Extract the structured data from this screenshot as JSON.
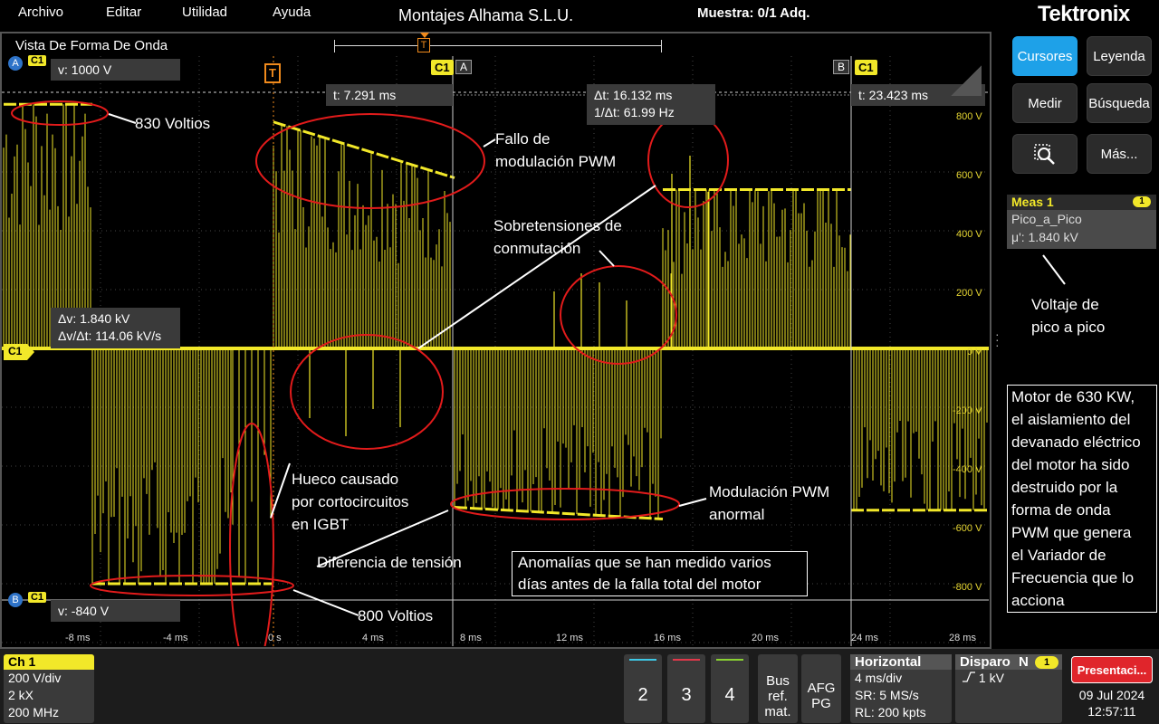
{
  "menu": {
    "items": [
      "Archivo",
      "Editar",
      "Utilidad",
      "Ayuda"
    ],
    "title": "Montajes Alhama S.L.U.",
    "sample": "Muestra: 0/1 Adq.",
    "brand": "Tektronix"
  },
  "waveform": {
    "title": "Vista De Forma De Onda",
    "trigger_marker": "T",
    "channel_tag": "C1",
    "cursor_a_label": "A",
    "cursor_b_label": "B",
    "cursor_v_top": "v: 1000 V",
    "cursor_v_bottom": "v: -840 V",
    "t_a": "t: 7.291 ms",
    "t_b": "t: 23.423 ms",
    "delta_t": "Δt: 16.132 ms",
    "inv_delta_t": "1/Δt: 61.99 Hz",
    "delta_v": "Δv: 1.840 kV",
    "dv_dt": "Δv/Δt: 114.06 kV/s",
    "y_labels": [
      "800 V",
      "600 V",
      "400 V",
      "200 V",
      "0 V",
      "-200 V",
      "-400 V",
      "-600 V",
      "-800 V"
    ],
    "x_labels": [
      "-8 ms",
      "-4 ms",
      "0 s",
      "4 ms",
      "8 ms",
      "12 ms",
      "16 ms",
      "20 ms",
      "24 ms",
      "28 ms"
    ],
    "trace_color": "#f2e829",
    "annotation_color": "#e21b1b"
  },
  "annotations": {
    "v830": "830 Voltios",
    "pwm_fail": [
      "Fallo de",
      "modulación PWM"
    ],
    "overvolt": [
      "Sobretensiones de",
      "conmutación"
    ],
    "hole": [
      "Hueco causado",
      "por cortocircuitos",
      "en IGBT"
    ],
    "pwm_abnormal": [
      "Modulación PWM",
      "anormal"
    ],
    "diff": "Diferencia de tensión",
    "v800": "800 Voltios",
    "anomalies": [
      "Anomalías que se han medido varios",
      "días antes de la falla total del motor"
    ],
    "peak_to_peak": [
      "Voltaje de",
      "pico a pico"
    ],
    "motor_note": [
      "Motor de 630 KW,",
      "el aislamiento del",
      "devanado eléctrico",
      "del motor ha sido",
      "destruido por la",
      "forma de onda",
      "PWM que genera",
      "el Variador de",
      "Frecuencia que lo",
      "acciona"
    ]
  },
  "right_panel": {
    "cursors": "Cursores",
    "legend": "Leyenda",
    "measure": "Medir",
    "search": "Búsqueda",
    "more": "Más...",
    "meas": {
      "title": "Meas 1",
      "num": "1",
      "name": "Pico_a_Pico",
      "value": "μ': 1.840 kV"
    }
  },
  "bottom": {
    "ch1": {
      "title": "Ch 1",
      "scale": "200 V/div",
      "impedance": "2 kX",
      "bandwidth": "200 MHz"
    },
    "channels": [
      {
        "label": "2",
        "color": "#3ec8e6"
      },
      {
        "label": "3",
        "color": "#e2384a"
      },
      {
        "label": "4",
        "color": "#8ad232"
      }
    ],
    "bus": [
      "Bus",
      "ref.",
      "mat."
    ],
    "afg": [
      "AFG",
      "PG"
    ],
    "horizontal": {
      "title": "Horizontal",
      "scale": "4 ms/div",
      "sr": "SR: 5 MS/s",
      "rl": "RL: 200 kpts"
    },
    "trigger": {
      "title": "Disparo",
      "mode": "N",
      "num": "1",
      "level": "1 kV"
    },
    "presentation": "Presentaci...",
    "date": "09 Jul 2024",
    "time": "12:57:11"
  }
}
